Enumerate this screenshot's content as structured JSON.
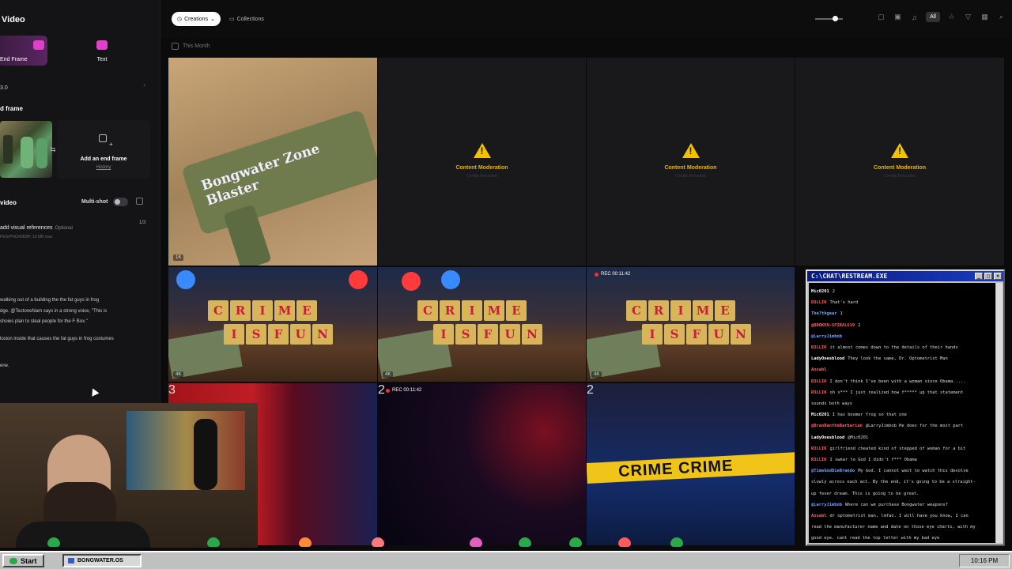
{
  "left_panel": {
    "title": "Video",
    "modes": [
      {
        "label": "End Frame"
      },
      {
        "label": "Text"
      }
    ],
    "model": "3.0",
    "end_frame_label": "d frame",
    "add_end_frame": {
      "title": "Add an end frame",
      "history": "History"
    },
    "video_label": "video",
    "multishot_label": "Multi-shot",
    "refs": {
      "label": "add visual references",
      "optional": "Optional",
      "count": "1/3",
      "sub": "PEG/PNG/WEBP, 10 MB max"
    },
    "prompt_lines": [
      "walking out of a building the the fat guys in frog",
      "dge. @TectoneNam   says in a strong voice, \"This is",
      "shoies plan to steal people for the F Box.\"",
      "losion inside that causes the fat guys in frog costumes",
      "ene."
    ]
  },
  "topbar": {
    "creations": "Creations",
    "collections": "Collections",
    "filter_all": "All",
    "month_label": "This Month"
  },
  "grid": {
    "gun_text": "Bongwater Zone Blaster",
    "gun_badge": "1K",
    "moderation": {
      "title": "Content Moderation",
      "sub": "Credits Refunded"
    },
    "crime_blocks_row1": [
      "C",
      "R",
      "I",
      "M",
      "E"
    ],
    "crime_blocks_row2": [
      "I",
      "S",
      "F",
      "U",
      "N"
    ],
    "badge_4k": "4K",
    "rec_label": "REC 00:11:42",
    "tape_text": "CRIME   CRIME"
  },
  "chat": {
    "title": "C:\\CHAT\\RESTREAM.EXE",
    "messages": [
      {
        "user": "Mic0201",
        "color": "#ffffff",
        "text": "2"
      },
      {
        "user": "R3LLIK",
        "color": "#ff6060",
        "text": "That's hard"
      },
      {
        "user": "The7thgear",
        "color": "#6fa8ff",
        "text": "1"
      },
      {
        "user": "@BROKEN-SPIRAL619",
        "color": "#ff6060",
        "text": "2"
      },
      {
        "user": "@LarryJimbob",
        "color": "#6fa8ff",
        "text": ""
      },
      {
        "user": "R3LLIK",
        "color": "#ff6060",
        "text": "it almost comes down to the details of their hands"
      },
      {
        "user": "LadyOnesblood",
        "color": "#ffffff",
        "text": "They look the same, Dr. Optometrist Man"
      },
      {
        "user": "Aosabl",
        "color": "#ff6060",
        "text": ""
      },
      {
        "user": "R3LLIK",
        "color": "#ff6060",
        "text": "I don't think I've been with a woman since Obama....."
      },
      {
        "user": "R3LLIK",
        "color": "#ff6060",
        "text": "oh s*** I just realized how f***** up that statement"
      },
      {
        "user": "",
        "color": "#dddddd",
        "text": "sounds both ways"
      },
      {
        "user": "Mic0201",
        "color": "#ffffff",
        "text": "I has boomer frog so that one"
      },
      {
        "user": "@BranBantheBarbarian",
        "color": "#ff6060",
        "text": "@LarryJimbob He does for the most part"
      },
      {
        "user": "LadyOnesblood",
        "color": "#ffffff",
        "text": "@Mic0201"
      },
      {
        "user": "R3LLIK",
        "color": "#ff6060",
        "text": "girlfriend cheated kind of stepped of woman for a bit"
      },
      {
        "user": "R3LLIK",
        "color": "#ff6060",
        "text": "I swear to God I didn't f*** Obama"
      },
      {
        "user": "@TimeGodDieBrando",
        "color": "#6fa8ff",
        "text": "My God. I cannot wait to watch this devolve"
      },
      {
        "user": "",
        "color": "#dddddd",
        "text": "slowly across each act. By the end, it's going to be a straight-"
      },
      {
        "user": "",
        "color": "#dddddd",
        "text": "up fever dream. This is going to be great."
      },
      {
        "user": "@LarryJimbob",
        "color": "#6fa8ff",
        "text": "Where can we purchase Bongwater weapons?"
      },
      {
        "user": "Aosabl",
        "color": "#ff6060",
        "text": "dr optometrist man, lmfao. I will have you know, I can"
      },
      {
        "user": "",
        "color": "#dddddd",
        "text": "read the manufacturer name and date on those eye charts, with my"
      },
      {
        "user": "",
        "color": "#dddddd",
        "text": "good eye. cant read the top letter with my bad eye"
      }
    ]
  },
  "taskbar": {
    "start": "Start",
    "item": "BONGWATER.OS",
    "clock": "10:16 PM"
  },
  "colors": {
    "accent": "#e040c8",
    "warning": "#f2c200"
  }
}
